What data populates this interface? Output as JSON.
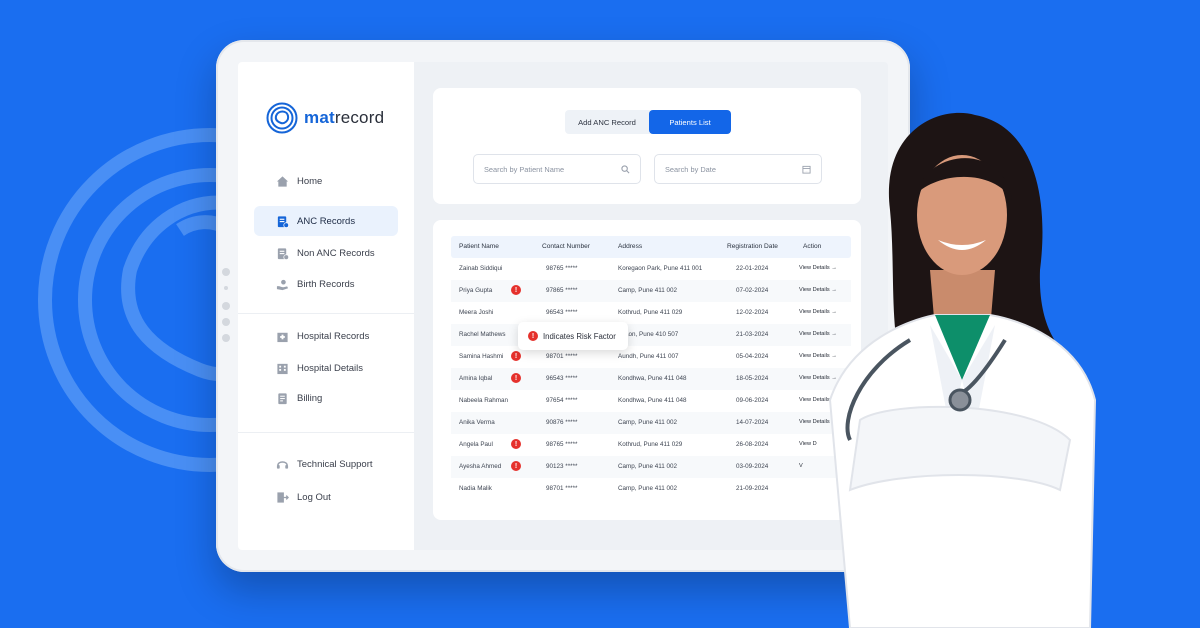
{
  "brand": {
    "prefix": "mat",
    "suffix": "record"
  },
  "sidebar": {
    "items": [
      {
        "label": "Home",
        "icon": "home-icon"
      },
      {
        "label": "ANC Records",
        "icon": "clipboard-icon",
        "active": true
      },
      {
        "label": "Non ANC Records",
        "icon": "document-icon"
      },
      {
        "label": "Birth Records",
        "icon": "hands-baby-icon"
      },
      {
        "label": "Hospital Records",
        "icon": "hospital-icon"
      },
      {
        "label": "Hospital Details",
        "icon": "building-icon"
      },
      {
        "label": "Billing",
        "icon": "bill-icon"
      },
      {
        "label": "Technical Support",
        "icon": "support-icon"
      },
      {
        "label": "Log Out",
        "icon": "logout-icon"
      }
    ]
  },
  "tabs": {
    "add": "Add ANC Record",
    "list": "Patients List"
  },
  "search": {
    "name_placeholder": "Search by Patient Name",
    "date_placeholder": "Search by Date"
  },
  "table": {
    "headers": [
      "Patient Name",
      "Contact Number",
      "Address",
      "Registration Date",
      "Action"
    ],
    "rows": [
      {
        "name": "Zainab Siddiqui",
        "contact": "98765 *****",
        "address": "Koregaon Park, Pune 411 001",
        "date": "22-01-2024",
        "action": "View Details",
        "risk": false
      },
      {
        "name": "Priya Gupta",
        "contact": "97865 *****",
        "address": "Camp, Pune 411 002",
        "date": "07-02-2024",
        "action": "View Details",
        "risk": true
      },
      {
        "name": "Meera Joshi",
        "contact": "96543 *****",
        "address": "Kothrud, Pune 411 029",
        "date": "12-02-2024",
        "action": "View Details",
        "risk": false
      },
      {
        "name": "Rachel Mathews",
        "contact": "",
        "address": "egaon, Pune 410 507",
        "date": "21-03-2024",
        "action": "View Details",
        "risk": false
      },
      {
        "name": "Samina Hashmi",
        "contact": "98701 *****",
        "address": "Aundh, Pune 411 007",
        "date": "05-04-2024",
        "action": "View Details",
        "risk": true
      },
      {
        "name": "Amina Iqbal",
        "contact": "96543 *****",
        "address": "Kondhwa, Pune 411 048",
        "date": "18-05-2024",
        "action": "View Details",
        "risk": true
      },
      {
        "name": "Nabeela Rahman",
        "contact": "97654 *****",
        "address": "Kondhwa, Pune 411 048",
        "date": "09-06-2024",
        "action": "View Details",
        "risk": false
      },
      {
        "name": "Anika Verma",
        "contact": "90876 *****",
        "address": "Camp, Pune 411 002",
        "date": "14-07-2024",
        "action": "View Details",
        "risk": false
      },
      {
        "name": "Angela Paul",
        "contact": "98765 *****",
        "address": "Kothrud, Pune 411 029",
        "date": "26-08-2024",
        "action": "View D",
        "risk": true
      },
      {
        "name": "Ayesha Ahmed",
        "contact": "90123 *****",
        "address": "Camp, Pune 411 002",
        "date": "03-09-2024",
        "action": "V",
        "risk": true
      },
      {
        "name": "Nadia Malik",
        "contact": "98701 *****",
        "address": "Camp, Pune 411 002",
        "date": "21-09-2024",
        "action": "",
        "risk": false
      }
    ]
  },
  "tooltip": {
    "text": "Indicates Risk Factor"
  },
  "colors": {
    "background": "#1a6ef0",
    "accent": "#1366e8",
    "risk": "#e5312c"
  }
}
